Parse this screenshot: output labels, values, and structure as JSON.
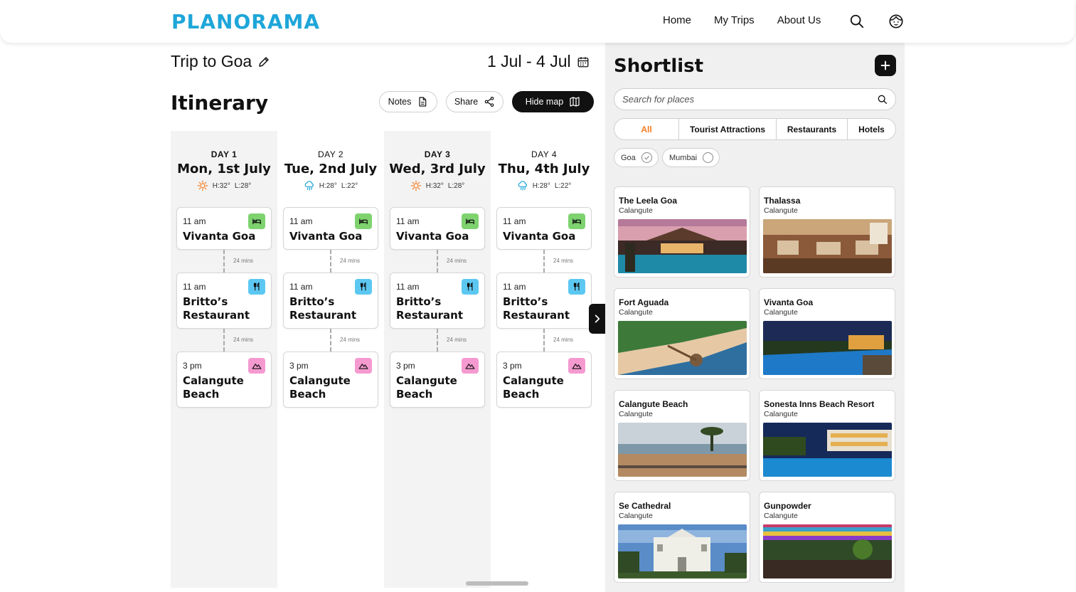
{
  "header": {
    "logo": "PLANORAMA",
    "nav": [
      "Home",
      "My Trips",
      "About Us"
    ],
    "icons": [
      "search-icon",
      "user-avatar-icon"
    ]
  },
  "trip": {
    "title": "Trip to Goa",
    "date_range": "1 Jul - 4 Jul"
  },
  "itinerary": {
    "title": "Itinerary",
    "buttons": {
      "notes": "Notes",
      "share": "Share",
      "hide_map": "Hide map"
    },
    "days": [
      {
        "label": "DAY 1",
        "date": "Mon, 1st July",
        "weather_icon": "sun-icon",
        "high": "H:32°",
        "low": "L:28°",
        "items": [
          {
            "time": "11 am",
            "place": "Vivanta Goa",
            "type": "hotel"
          },
          {
            "time": "11 am",
            "place": "Britto’s Restaurant",
            "type": "restaurant"
          },
          {
            "time": "3 pm",
            "place": "Calangute Beach",
            "type": "attraction"
          }
        ],
        "travel": [
          "24 mins",
          "24 mins"
        ]
      },
      {
        "label": "DAY 2",
        "date": "Tue, 2nd July",
        "weather_icon": "rain-icon",
        "high": "H:28°",
        "low": "L:22°",
        "items": [
          {
            "time": "11 am",
            "place": "Vivanta Goa",
            "type": "hotel"
          },
          {
            "time": "11 am",
            "place": "Britto’s Restaurant",
            "type": "restaurant"
          },
          {
            "time": "3 pm",
            "place": "Calangute Beach",
            "type": "attraction"
          }
        ],
        "travel": [
          "24 mins",
          "24 mins"
        ]
      },
      {
        "label": "DAY 3",
        "date": "Wed, 3rd July",
        "weather_icon": "sun-icon",
        "high": "H:32°",
        "low": "L:28°",
        "items": [
          {
            "time": "11 am",
            "place": "Vivanta Goa",
            "type": "hotel"
          },
          {
            "time": "11 am",
            "place": "Britto’s Restaurant",
            "type": "restaurant"
          },
          {
            "time": "3 pm",
            "place": "Calangute Beach",
            "type": "attraction"
          }
        ],
        "travel": [
          "24 mins",
          "24 mins"
        ]
      },
      {
        "label": "DAY 4",
        "date": "Thu, 4th July",
        "weather_icon": "rain-icon",
        "high": "H:28°",
        "low": "L:22°",
        "items": [
          {
            "time": "11 am",
            "place": "Vivanta Goa",
            "type": "hotel"
          },
          {
            "time": "11 am",
            "place": "Britto’s Restaurant",
            "type": "restaurant"
          },
          {
            "time": "3 pm",
            "place": "Calangute Beach",
            "type": "attraction"
          }
        ],
        "travel": [
          "24 mins",
          "24 mins"
        ]
      }
    ]
  },
  "shortlist": {
    "title": "Shortlist",
    "search_placeholder": "Search for places",
    "tabs": [
      "All",
      "Tourist Attractions",
      "Restaurants",
      "Hotels"
    ],
    "active_tab": "All",
    "chips": [
      "Goa",
      "Mumbai"
    ],
    "places": [
      {
        "name": "The Leela Goa",
        "location": "Calangute"
      },
      {
        "name": "Thalassa",
        "location": "Calangute"
      },
      {
        "name": "Fort Aguada",
        "location": "Calangute"
      },
      {
        "name": "Vivanta Goa",
        "location": "Calangute"
      },
      {
        "name": "Calangute Beach",
        "location": "Calangute"
      },
      {
        "name": "Sonesta Inns Beach Resort",
        "location": "Calangute"
      },
      {
        "name": "Se Cathedral",
        "location": "Calangute"
      },
      {
        "name": "Gunpowder",
        "location": "Calangute"
      }
    ]
  },
  "colors": {
    "brand": "#1ea6d9",
    "accent": "#f47b20",
    "hotel_badge": "#7ed36f",
    "restaurant_badge": "#5cc8f2",
    "attraction_badge": "#f59ad0"
  }
}
